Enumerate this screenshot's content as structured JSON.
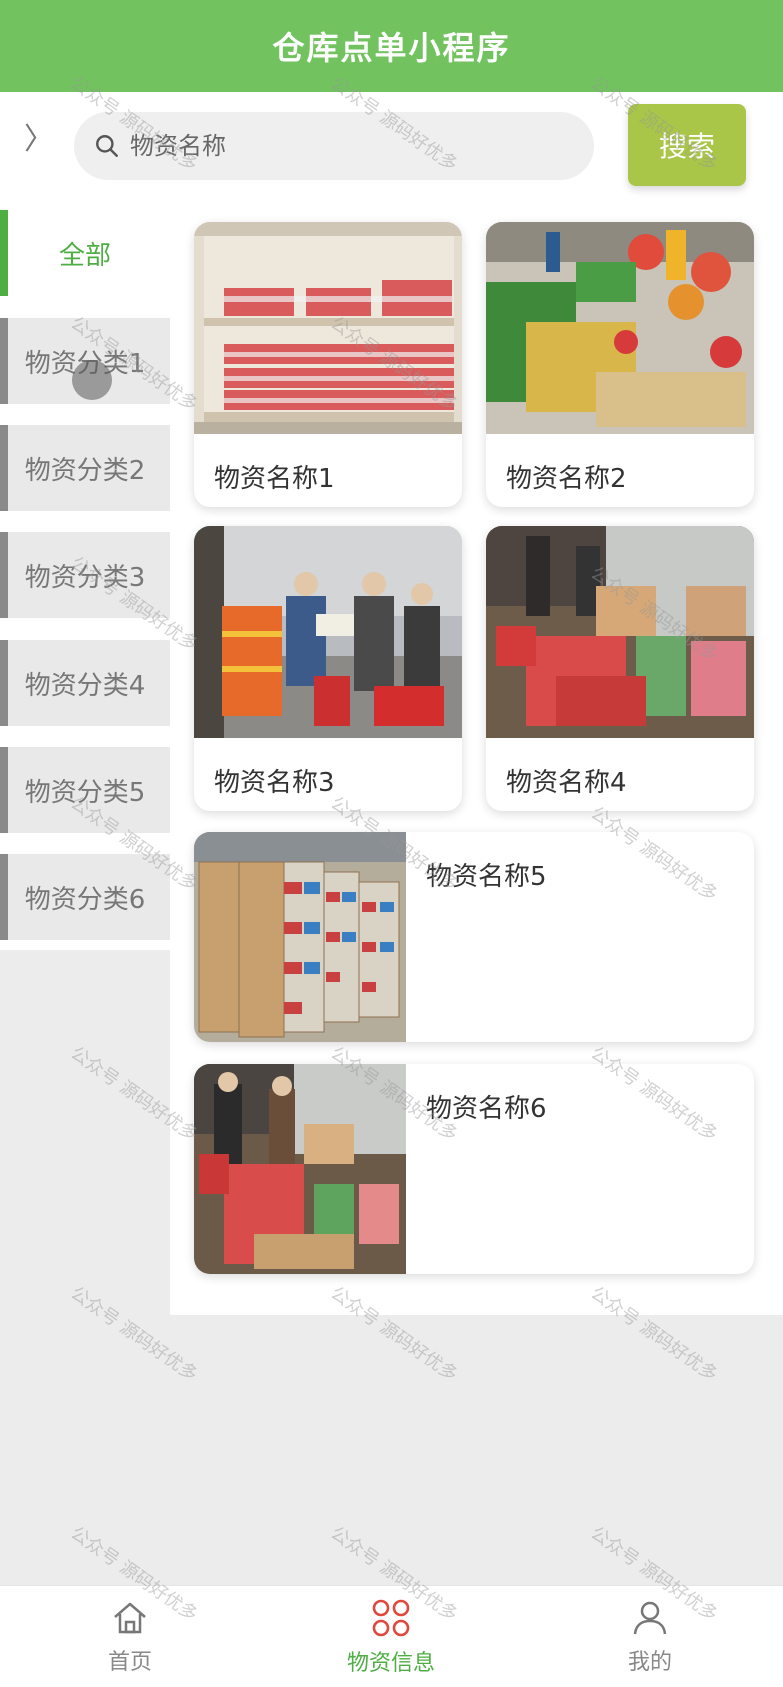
{
  "header": {
    "title": "仓库点单小程序"
  },
  "search": {
    "placeholder": "物资名称",
    "button_label": "搜索",
    "expand_glyph": "〉"
  },
  "sidebar": {
    "items": [
      {
        "label": "全部",
        "active": true
      },
      {
        "label": "物资分类1",
        "active": false
      },
      {
        "label": "物资分类2",
        "active": false
      },
      {
        "label": "物资分类3",
        "active": false
      },
      {
        "label": "物资分类4",
        "active": false
      },
      {
        "label": "物资分类5",
        "active": false
      },
      {
        "label": "物资分类6",
        "active": false
      }
    ]
  },
  "products": [
    {
      "name": "物资名称1"
    },
    {
      "name": "物资名称2"
    },
    {
      "name": "物资名称3"
    },
    {
      "name": "物资名称4"
    },
    {
      "name": "物资名称5"
    },
    {
      "name": "物资名称6"
    }
  ],
  "tabbar": {
    "items": [
      {
        "label": "首页",
        "icon": "home-icon",
        "active": false
      },
      {
        "label": "物资信息",
        "icon": "grid-icon",
        "active": true
      },
      {
        "label": "我的",
        "icon": "user-icon",
        "active": false
      }
    ]
  },
  "watermark": {
    "text": "公众号 源码好优多"
  },
  "colors": {
    "header": "#72c35f",
    "accent_green": "#4fae43",
    "search_button": "#a9c648",
    "tab_active": "#e0483e"
  }
}
